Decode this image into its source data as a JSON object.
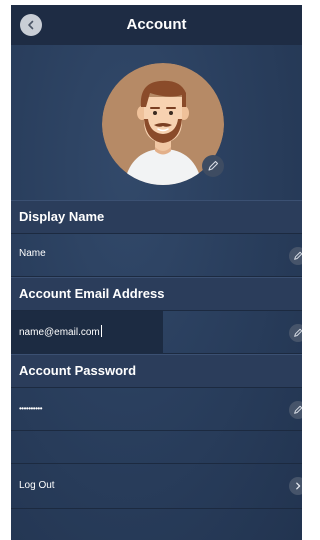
{
  "header": {
    "title": "Account",
    "back_icon": "chevron-left-icon"
  },
  "profile": {
    "avatar_icon": "user-avatar-icon",
    "edit_icon": "pencil-icon"
  },
  "sections": {
    "display_name": {
      "label": "Display Name",
      "value": "Name"
    },
    "email": {
      "label": "Account Email Address",
      "value": "name@email.com"
    },
    "password": {
      "label": "Account Password",
      "value": "••••••••••"
    }
  },
  "logout": {
    "label": "Log Out",
    "icon": "chevron-right-icon"
  },
  "colors": {
    "background": "#2a3f5e",
    "header": "#1e2c44",
    "avatar_bg": "#b68a66"
  }
}
